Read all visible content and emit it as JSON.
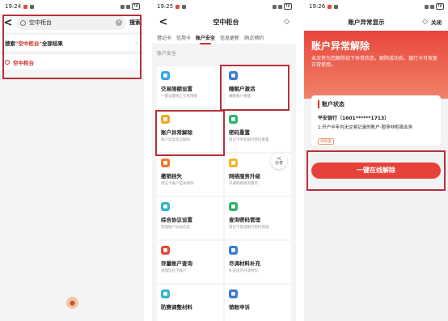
{
  "panel1": {
    "status": {
      "time": "19:24",
      "battery": "78"
    },
    "search": {
      "value": "空中柜台",
      "button": "搜索"
    },
    "results": [
      {
        "prefix": "搜索",
        "highlight": "\"空中柜台\"",
        "suffix": "全部结果"
      },
      {
        "prefix": "",
        "highlight": "空中柜台",
        "suffix": ""
      }
    ]
  },
  "panel2": {
    "status": {
      "time": "19:25",
      "battery": "78"
    },
    "title": "空中柜台",
    "tabs": [
      "借记卡",
      "信用卡",
      "账户安全",
      "信息更新",
      "网点预约"
    ],
    "active_tab": "账户安全",
    "section": "账户安全",
    "share_label": "分享",
    "tiles": [
      {
        "name": "交易限额设置",
        "desc": "一键设置线上交易限额",
        "color": "#3ca7e8",
        "icon": "limit-icon"
      },
      {
        "name": "睡眠户激活",
        "desc": "睡眠账户唤醒",
        "color": "#3a7bd5",
        "icon": "moon-icon"
      },
      {
        "name": "账户异常解除",
        "desc": "账户异常状态解除",
        "color": "#f0a623",
        "icon": "unlock-icon"
      },
      {
        "name": "密码重置",
        "desc": "借记卡手机银行密码重置",
        "color": "#2fb36b",
        "icon": "lock-icon"
      },
      {
        "name": "撤销挂失",
        "desc": "借记卡账户挂失解除",
        "color": "#f07a2a",
        "icon": "card-icon"
      },
      {
        "name": "网络服务升级",
        "desc": "开通网络服务服务",
        "color": "#f0b52a",
        "icon": "shield-icon"
      },
      {
        "name": "综合协议设置",
        "desc": "管理账户协议信息",
        "color": "#34b4c8",
        "icon": "doc-icon"
      },
      {
        "name": "查询密码管理",
        "desc": "借记卡电话银行密码管理",
        "color": "#2fb36b",
        "icon": "key-icon"
      },
      {
        "name": "存量账户查询",
        "desc": "清理您名下账户",
        "color": "#e24a3a",
        "icon": "search-icon"
      },
      {
        "name": "尽调材料补充",
        "desc": "补充您的尽调材料",
        "color": "#3a7bd5",
        "icon": "file-icon"
      },
      {
        "name": "防赛调整材料",
        "desc": "",
        "color": "#34b4c8",
        "icon": "doc2-icon"
      },
      {
        "name": "销账申诉",
        "desc": "",
        "color": "#3a7bd5",
        "icon": "appeal-icon"
      }
    ]
  },
  "panel3": {
    "status": {
      "time": "19:26",
      "battery": "78"
    },
    "title": "账户异常显示",
    "close": "关闭",
    "banner_title": "账户异常解除",
    "banner_sub": "本次将为您解除如下异常状态，解除成功后，银行卡可恢复正常使用。",
    "card_title": "账户状态",
    "bank": "平安银行（1601******1713）",
    "status_line": "1.开户半年内无交易记录的账户-暂停非柜面业务",
    "tag": "待处理",
    "button": "一键在线解除"
  }
}
